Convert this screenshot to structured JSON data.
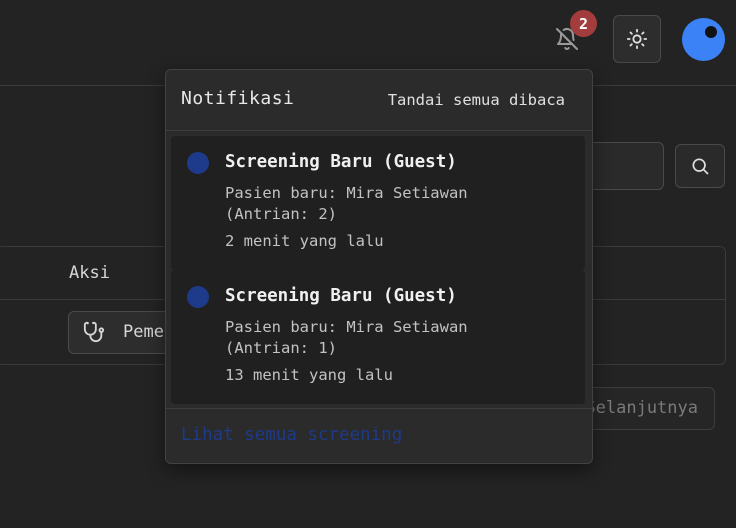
{
  "header": {
    "notification_count": "2",
    "icons": {
      "bell": "bell-off-icon",
      "theme": "sun-icon",
      "avatar": "user-avatar"
    },
    "colors": {
      "avatar": "#3b82f6",
      "badge": "#a33c3c"
    }
  },
  "background": {
    "table": {
      "aksi_header": "Aksi",
      "action_label": "Pemeriksaan"
    },
    "pagination": {
      "next_label": "Selanjutnya"
    }
  },
  "notifications": {
    "title": "Notifikasi",
    "mark_all_read": "Tandai semua dibaca",
    "items": [
      {
        "title": "Screening Baru (Guest)",
        "message": "Pasien baru: Mira Setiawan (Antrian: 2)",
        "time": "2 menit yang lalu"
      },
      {
        "title": "Screening Baru (Guest)",
        "message": "Pasien baru: Mira Setiawan (Antrian: 1)",
        "time": "13 menit yang lalu"
      }
    ],
    "see_all": "Lihat semua screening",
    "colors": {
      "unread_dot": "#1e3a8a",
      "link": "#1e3a8a"
    }
  }
}
